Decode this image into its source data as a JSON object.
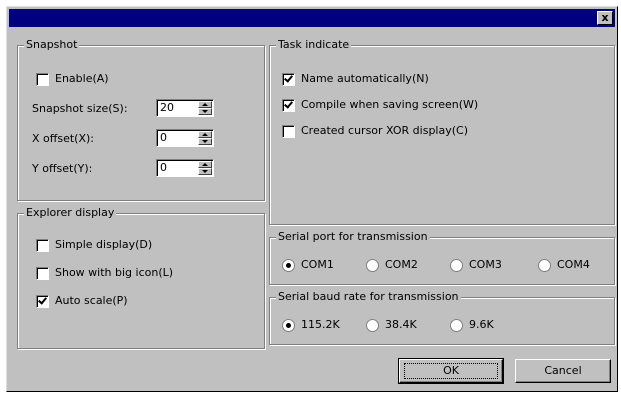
{
  "window": {
    "title": "",
    "close_label": "x"
  },
  "snapshot": {
    "title": "Snapshot",
    "enable_label": "Enable(A)",
    "enable_checked": false,
    "size_label": "Snapshot size(S):",
    "size_value": "20",
    "x_label": "X offset(X):",
    "x_value": "0",
    "y_label": "Y offset(Y):",
    "y_value": "0"
  },
  "explorer": {
    "title": "Explorer display",
    "simple_label": "Simple display(D)",
    "simple_checked": false,
    "bigicon_label": "Show with big icon(L)",
    "bigicon_checked": false,
    "autoscale_label": "Auto scale(P)",
    "autoscale_checked": true
  },
  "task": {
    "title": "Task indicate",
    "name_label": "Name automatically(N)",
    "name_checked": true,
    "compile_label": "Compile when saving screen(W)",
    "compile_checked": true,
    "cursor_label": "Created cursor XOR display(C)",
    "cursor_checked": false
  },
  "serial_port": {
    "title": "Serial port for transmission",
    "options": [
      "COM1",
      "COM2",
      "COM3",
      "COM4"
    ],
    "selected": "COM1"
  },
  "baud": {
    "title": "Serial baud rate for transmission",
    "options": [
      "115.2K",
      "38.4K",
      "9.6K"
    ],
    "selected": "115.2K"
  },
  "buttons": {
    "ok_label": "OK",
    "cancel_label": "Cancel"
  }
}
